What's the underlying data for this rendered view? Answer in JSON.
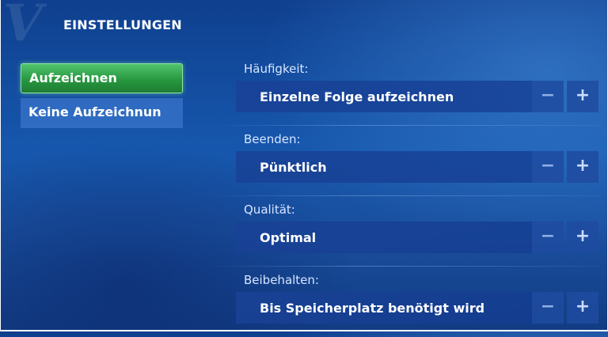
{
  "header": {
    "logo_mark": "V",
    "title": "EINSTELLUNGEN"
  },
  "nav": {
    "items": [
      {
        "label": "Aufzeichnen",
        "selected": true
      },
      {
        "label": "Keine Aufzeichnun",
        "selected": false
      }
    ]
  },
  "settings": [
    {
      "label": "Häufigkeit:",
      "value": "Einzelne Folge aufzeichnen",
      "minus": "−",
      "plus": "+"
    },
    {
      "label": "Beenden:",
      "value": "Pünktlich",
      "minus": "−",
      "plus": "+"
    },
    {
      "label": "Qualität:",
      "value": "Optimal",
      "minus": "−",
      "plus": "+"
    },
    {
      "label": "Beibehalten:",
      "value": "Bis Speicherplatz benötigt wird",
      "minus": "−",
      "plus": "+"
    }
  ],
  "colors": {
    "background": "#1657ad",
    "selected_green": "#27983f",
    "value_box": "#193f96"
  }
}
